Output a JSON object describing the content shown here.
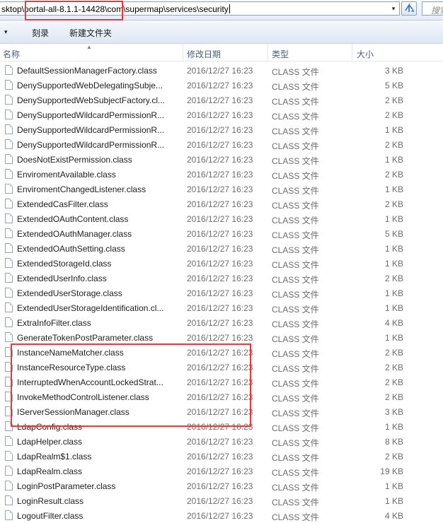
{
  "address_bar": {
    "path": "sktop\\portal-all-8.1.1-14428\\com\\supermap\\services\\security",
    "dropdown_glyph": "▾"
  },
  "search": {
    "placeholder": "搜索"
  },
  "toolbar": {
    "menu_glyph": "▾",
    "burn_label": "刻录",
    "new_folder_label": "新建文件夹"
  },
  "columns": {
    "name": "名称",
    "modified": "修改日期",
    "type": "类型",
    "size": "大小"
  },
  "files": [
    {
      "name": "DefaultSessionManagerFactory.class",
      "modified": "2016/12/27 16:23",
      "type": "CLASS 文件",
      "size": "3 KB"
    },
    {
      "name": "DenySupportedWebDelegatingSubje...",
      "modified": "2016/12/27 16:23",
      "type": "CLASS 文件",
      "size": "5 KB"
    },
    {
      "name": "DenySupportedWebSubjectFactory.cl...",
      "modified": "2016/12/27 16:23",
      "type": "CLASS 文件",
      "size": "2 KB"
    },
    {
      "name": "DenySupportedWildcardPermissionR...",
      "modified": "2016/12/27 16:23",
      "type": "CLASS 文件",
      "size": "2 KB"
    },
    {
      "name": "DenySupportedWildcardPermissionR...",
      "modified": "2016/12/27 16:23",
      "type": "CLASS 文件",
      "size": "1 KB"
    },
    {
      "name": "DenySupportedWildcardPermissionR...",
      "modified": "2016/12/27 16:23",
      "type": "CLASS 文件",
      "size": "2 KB"
    },
    {
      "name": "DoesNotExistPermission.class",
      "modified": "2016/12/27 16:23",
      "type": "CLASS 文件",
      "size": "1 KB"
    },
    {
      "name": "EnviromentAvailable.class",
      "modified": "2016/12/27 16:23",
      "type": "CLASS 文件",
      "size": "2 KB"
    },
    {
      "name": "EnviromentChangedListener.class",
      "modified": "2016/12/27 16:23",
      "type": "CLASS 文件",
      "size": "1 KB"
    },
    {
      "name": "ExtendedCasFilter.class",
      "modified": "2016/12/27 16:23",
      "type": "CLASS 文件",
      "size": "2 KB"
    },
    {
      "name": "ExtendedOAuthContent.class",
      "modified": "2016/12/27 16:23",
      "type": "CLASS 文件",
      "size": "1 KB"
    },
    {
      "name": "ExtendedOAuthManager.class",
      "modified": "2016/12/27 16:23",
      "type": "CLASS 文件",
      "size": "5 KB"
    },
    {
      "name": "ExtendedOAuthSetting.class",
      "modified": "2016/12/27 16:23",
      "type": "CLASS 文件",
      "size": "1 KB"
    },
    {
      "name": "ExtendedStorageId.class",
      "modified": "2016/12/27 16:23",
      "type": "CLASS 文件",
      "size": "1 KB"
    },
    {
      "name": "ExtendedUserInfo.class",
      "modified": "2016/12/27 16:23",
      "type": "CLASS 文件",
      "size": "2 KB"
    },
    {
      "name": "ExtendedUserStorage.class",
      "modified": "2016/12/27 16:23",
      "type": "CLASS 文件",
      "size": "1 KB"
    },
    {
      "name": "ExtendedUserStorageIdentification.cl...",
      "modified": "2016/12/27 16:23",
      "type": "CLASS 文件",
      "size": "1 KB"
    },
    {
      "name": "ExtraInfoFilter.class",
      "modified": "2016/12/27 16:23",
      "type": "CLASS 文件",
      "size": "4 KB"
    },
    {
      "name": "GenerateTokenPostParameter.class",
      "modified": "2016/12/27 16:23",
      "type": "CLASS 文件",
      "size": "1 KB"
    },
    {
      "name": "InstanceNameMatcher.class",
      "modified": "2016/12/27 16:23",
      "type": "CLASS 文件",
      "size": "2 KB"
    },
    {
      "name": "InstanceResourceType.class",
      "modified": "2016/12/27 16:23",
      "type": "CLASS 文件",
      "size": "2 KB"
    },
    {
      "name": "InterruptedWhenAccountLockedStrat...",
      "modified": "2016/12/27 16:23",
      "type": "CLASS 文件",
      "size": "2 KB"
    },
    {
      "name": "InvokeMethodControlListener.class",
      "modified": "2016/12/27 16:23",
      "type": "CLASS 文件",
      "size": "2 KB"
    },
    {
      "name": "IServerSessionManager.class",
      "modified": "2016/12/27 16:23",
      "type": "CLASS 文件",
      "size": "3 KB"
    },
    {
      "name": "LdapConfig.class",
      "modified": "2016/12/27 16:23",
      "type": "CLASS 文件",
      "size": "1 KB"
    },
    {
      "name": "LdapHelper.class",
      "modified": "2016/12/27 16:23",
      "type": "CLASS 文件",
      "size": "8 KB"
    },
    {
      "name": "LdapRealm$1.class",
      "modified": "2016/12/27 16:23",
      "type": "CLASS 文件",
      "size": "2 KB"
    },
    {
      "name": "LdapRealm.class",
      "modified": "2016/12/27 16:23",
      "type": "CLASS 文件",
      "size": "19 KB"
    },
    {
      "name": "LoginPostParameter.class",
      "modified": "2016/12/27 16:23",
      "type": "CLASS 文件",
      "size": "1 KB"
    },
    {
      "name": "LoginResult.class",
      "modified": "2016/12/27 16:23",
      "type": "CLASS 文件",
      "size": "1 KB"
    },
    {
      "name": "LogoutFilter.class",
      "modified": "2016/12/27 16:23",
      "type": "CLASS 文件",
      "size": "4 KB"
    }
  ],
  "colors": {
    "highlight": "#e8383d",
    "header_text": "#4c607a",
    "meta_text": "#6d6d6d"
  }
}
